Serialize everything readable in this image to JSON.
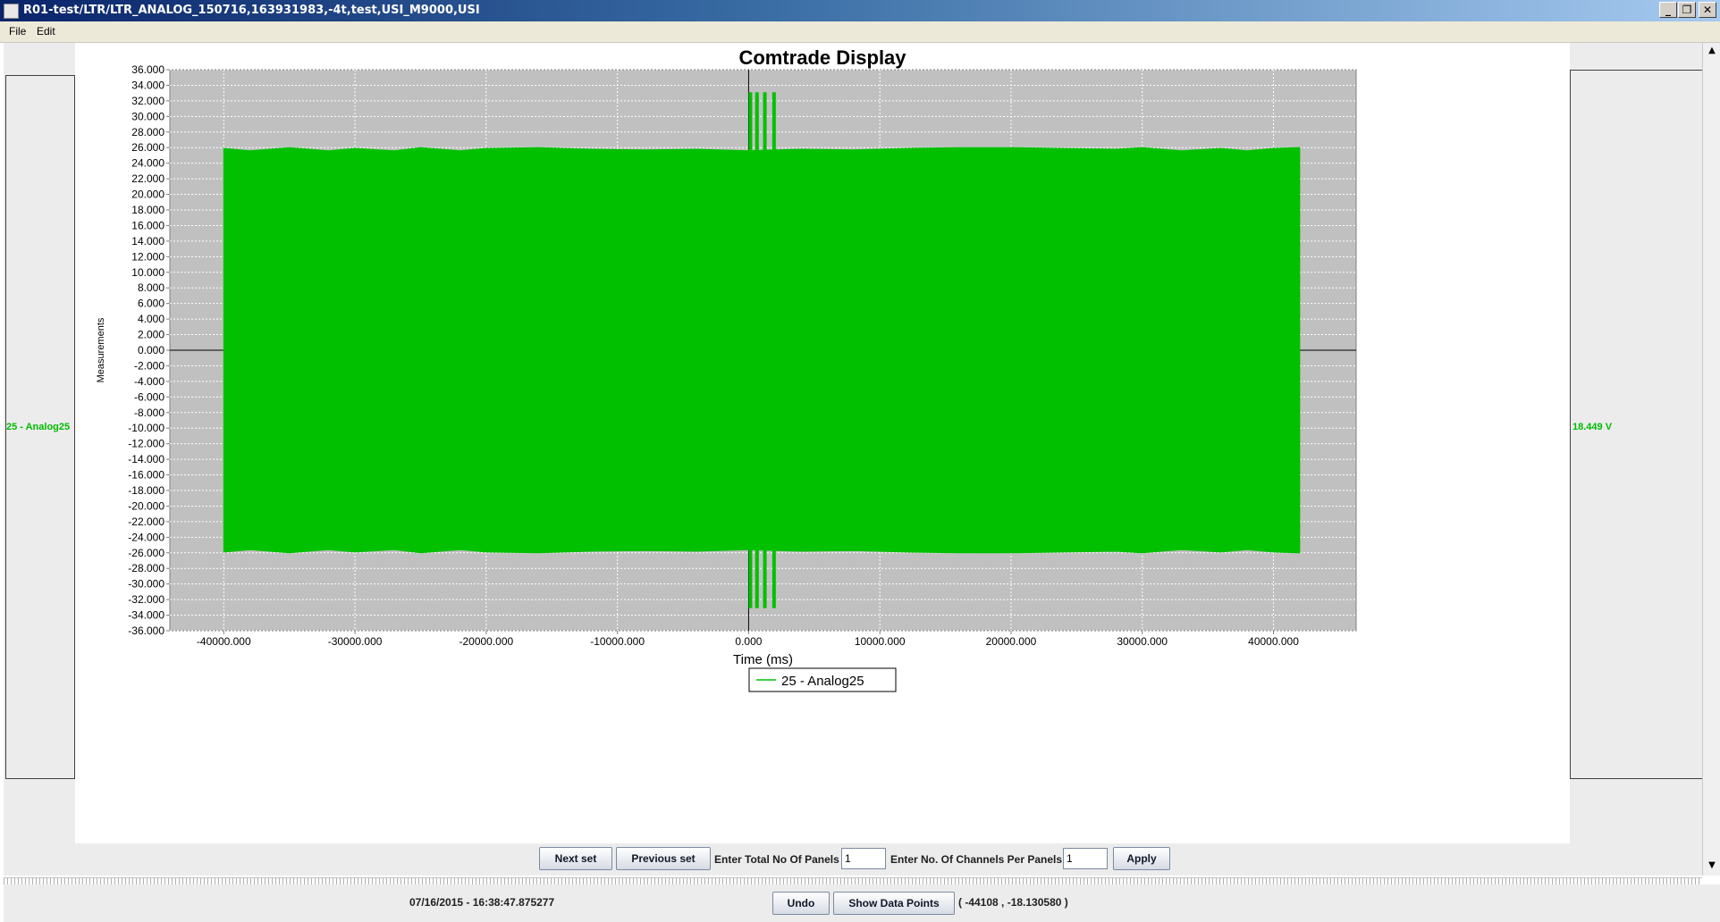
{
  "window": {
    "title": "R01-test/LTR/LTR_ANALOG_150716,163931983,-4t,test,USI_M9000,USI",
    "minimize_glyph": "_",
    "restore_glyph": "❐",
    "close_glyph": "✕"
  },
  "menu": {
    "items": [
      "File",
      "Edit"
    ]
  },
  "side": {
    "left_channel_label": "25 - Analog25",
    "right_value": "18.449 V"
  },
  "chart_data": {
    "type": "area",
    "title": "Comtrade Display",
    "xlabel": "Time (ms)",
    "ylabel": "Measurements",
    "xlim": [
      -44108,
      46300
    ],
    "ylim": [
      -36,
      36
    ],
    "grid": true,
    "legend_position": "bottom-center",
    "x_ticks": [
      -40000,
      -30000,
      -20000,
      -10000,
      0,
      10000,
      20000,
      30000,
      40000
    ],
    "x_tick_labels": [
      "-40000.000",
      "-30000.000",
      "-20000.000",
      "-10000.000",
      "0.000",
      "10000.000",
      "20000.000",
      "30000.000",
      "40000.000"
    ],
    "y_ticks": [
      36,
      34,
      32,
      30,
      28,
      26,
      24,
      22,
      20,
      18,
      16,
      14,
      12,
      10,
      8,
      6,
      4,
      2,
      0,
      -2,
      -4,
      -6,
      -8,
      -10,
      -12,
      -14,
      -16,
      -18,
      -20,
      -22,
      -24,
      -26,
      -28,
      -30,
      -32,
      -34,
      -36
    ],
    "y_tick_labels": [
      "36.000",
      "34.000",
      "32.000",
      "30.000",
      "28.000",
      "26.000",
      "24.000",
      "22.000",
      "20.000",
      "18.000",
      "16.000",
      "14.000",
      "12.000",
      "10.000",
      "8.000",
      "6.000",
      "4.000",
      "2.000",
      "0.000",
      "-2.000",
      "-4.000",
      "-6.000",
      "-8.000",
      "-10.000",
      "-12.000",
      "-14.000",
      "-16.000",
      "-18.000",
      "-20.000",
      "-22.000",
      "-24.000",
      "-26.000",
      "-28.000",
      "-30.000",
      "-32.000",
      "-34.000",
      "-36.000"
    ],
    "series": [
      {
        "name": "25 - Analog25",
        "color": "#00c000",
        "envelope_x": [
          -40000,
          -38000,
          -35000,
          -32000,
          -30000,
          -27000,
          -25000,
          -22000,
          -20000,
          -16000,
          -12000,
          -8000,
          -4000,
          0,
          4000,
          8000,
          12000,
          16000,
          20000,
          24000,
          28000,
          30000,
          33000,
          36000,
          38000,
          40000,
          42000
        ],
        "envelope_max": [
          25.9,
          25.6,
          26.0,
          25.6,
          25.9,
          25.6,
          26.0,
          25.6,
          25.9,
          26.0,
          25.8,
          25.7,
          25.8,
          25.6,
          25.8,
          25.7,
          25.9,
          26.0,
          26.0,
          25.9,
          25.8,
          26.0,
          25.6,
          25.9,
          25.6,
          25.9,
          26.0
        ],
        "envelope_min": [
          -25.9,
          -25.6,
          -26.0,
          -25.6,
          -25.9,
          -25.6,
          -26.0,
          -25.6,
          -25.9,
          -26.0,
          -25.8,
          -25.7,
          -25.8,
          -25.6,
          -25.8,
          -25.7,
          -25.9,
          -26.0,
          -26.0,
          -25.9,
          -25.8,
          -26.0,
          -25.6,
          -25.9,
          -25.6,
          -25.9,
          -26.0
        ],
        "spikes": {
          "x": [
            0,
            500,
            1100,
            1800
          ],
          "max": 33.1,
          "min": -33.1
        }
      }
    ]
  },
  "controls": {
    "next_set": "Next set",
    "previous_set": "Previous set",
    "total_panels_label": "Enter Total No Of Panels",
    "total_panels_value": "1",
    "channels_per_panel_label": "Enter No. Of Channels Per Panels",
    "channels_per_panel_value": "1",
    "apply": "Apply"
  },
  "status": {
    "timestamp": "07/16/2015 - 16:38:47.875277",
    "undo": "Undo",
    "show_data_points": "Show Data Points",
    "coordinates": "( -44108 , -18.130580 )"
  }
}
